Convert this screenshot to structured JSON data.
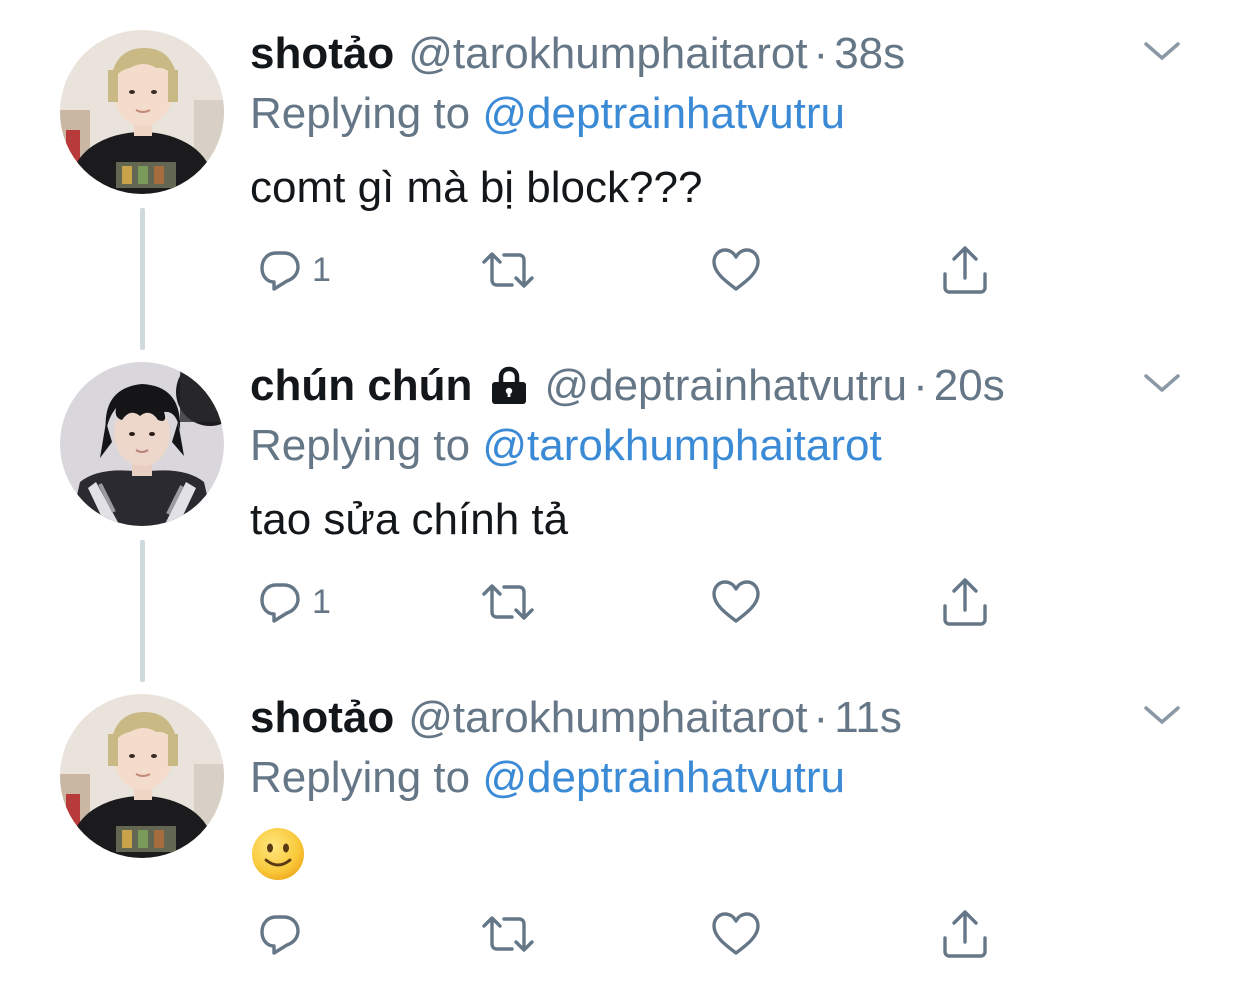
{
  "tweets": [
    {
      "name": "shotảo",
      "locked": false,
      "handle": "@tarokhumphaitarot",
      "separator": "·",
      "time": "38s",
      "replying_prefix": "Replying to",
      "replying_handle": "@deptrainhatvutru",
      "text": "comt gì mà bị block???",
      "reply_count": "1",
      "avatar_icon": "avatar-photo-blond"
    },
    {
      "name": "chún chún",
      "locked": true,
      "handle": "@deptrainhatvutru",
      "separator": "·",
      "time": "20s",
      "replying_prefix": "Replying to",
      "replying_handle": "@tarokhumphaitarot",
      "text": "tao sửa chính tả",
      "reply_count": "1",
      "avatar_icon": "avatar-photo-dark"
    },
    {
      "name": "shotảo",
      "locked": false,
      "handle": "@tarokhumphaitarot",
      "separator": "·",
      "time": "11s",
      "replying_prefix": "Replying to",
      "replying_handle": "@deptrainhatvutru",
      "text": "",
      "emoji": "slightly-smiling-face",
      "reply_count": "",
      "avatar_icon": "avatar-photo-blond"
    }
  ],
  "icons": {
    "reply": "reply-icon",
    "retweet": "retweet-icon",
    "like": "like-icon",
    "share": "share-icon",
    "menu": "chevron-down-icon",
    "lock": "lock-icon"
  },
  "colors": {
    "name": "#14171a",
    "muted": "#657786",
    "link": "#3a8ad6",
    "thread_line": "#cfd9de"
  }
}
